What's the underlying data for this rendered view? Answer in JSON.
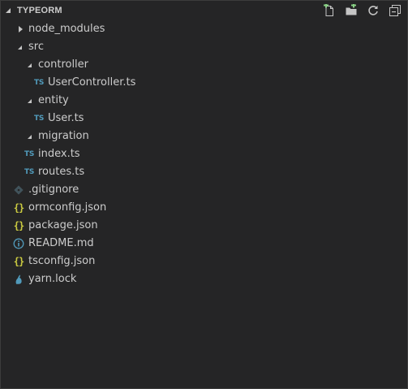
{
  "explorer": {
    "section_title": "TYPEORM",
    "actions": [
      {
        "name": "new-file-icon",
        "title": "New File"
      },
      {
        "name": "new-folder-icon",
        "title": "New Folder"
      },
      {
        "name": "refresh-icon",
        "title": "Refresh Explorer"
      },
      {
        "name": "collapse-all-icon",
        "title": "Collapse Folders in Explorer"
      }
    ],
    "items": [
      {
        "label": "node_modules",
        "type": "folder",
        "state": "collapsed",
        "icon": "chevron-right-icon"
      },
      {
        "label": "src",
        "type": "folder",
        "state": "expanded",
        "icon": "chevron-down-icon"
      },
      {
        "label": "controller",
        "type": "folder",
        "state": "expanded",
        "icon": "chevron-down-icon"
      },
      {
        "label": "UserController.ts",
        "type": "file",
        "icon": "typescript-icon",
        "badge": "TS"
      },
      {
        "label": "entity",
        "type": "folder",
        "state": "expanded",
        "icon": "chevron-down-icon"
      },
      {
        "label": "User.ts",
        "type": "file",
        "icon": "typescript-icon",
        "badge": "TS"
      },
      {
        "label": "migration",
        "type": "folder",
        "state": "expanded",
        "icon": "chevron-down-icon"
      },
      {
        "label": "index.ts",
        "type": "file",
        "icon": "typescript-icon",
        "badge": "TS"
      },
      {
        "label": "routes.ts",
        "type": "file",
        "icon": "typescript-icon",
        "badge": "TS"
      },
      {
        "label": ".gitignore",
        "type": "file",
        "icon": "git-icon"
      },
      {
        "label": "ormconfig.json",
        "type": "file",
        "icon": "json-icon",
        "badge": "{}"
      },
      {
        "label": "package.json",
        "type": "file",
        "icon": "json-icon",
        "badge": "{}"
      },
      {
        "label": "README.md",
        "type": "file",
        "icon": "info-icon"
      },
      {
        "label": "tsconfig.json",
        "type": "file",
        "icon": "json-icon",
        "badge": "{}"
      },
      {
        "label": "yarn.lock",
        "type": "file",
        "icon": "yarn-icon"
      }
    ]
  },
  "colors": {
    "background": "#252526",
    "text": "#cccccc",
    "typescript": "#519aba",
    "json": "#cbcb41",
    "info": "#519aba",
    "git": "#41535b",
    "new_item_accent": "#89d185"
  }
}
